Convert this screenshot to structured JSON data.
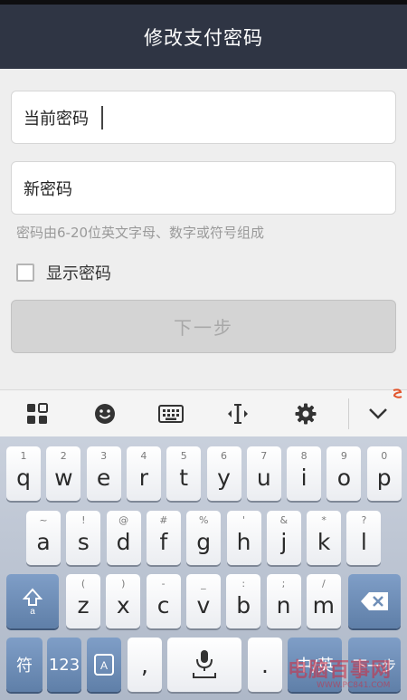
{
  "header": {
    "title": "修改支付密码"
  },
  "form": {
    "current_password_label": "当前密码",
    "new_password_label": "新密码",
    "hint": "密码由6-20位英文字母、数字或符号组成",
    "show_password_label": "显示密码",
    "next_button_label": "下一步"
  },
  "keyboard_toolbar": {
    "icons": [
      "grid-icon",
      "emoji-icon",
      "keyboard-icon",
      "text-cursor-icon",
      "gear-icon",
      "chevron-down-icon"
    ]
  },
  "keyboard": {
    "row1": [
      {
        "main": "q",
        "sub": "1"
      },
      {
        "main": "w",
        "sub": "2"
      },
      {
        "main": "e",
        "sub": "3"
      },
      {
        "main": "r",
        "sub": "4"
      },
      {
        "main": "t",
        "sub": "5"
      },
      {
        "main": "y",
        "sub": "6"
      },
      {
        "main": "u",
        "sub": "7"
      },
      {
        "main": "i",
        "sub": "8"
      },
      {
        "main": "o",
        "sub": "9"
      },
      {
        "main": "p",
        "sub": "0"
      }
    ],
    "row2": [
      {
        "main": "a",
        "sub": "~"
      },
      {
        "main": "s",
        "sub": "!"
      },
      {
        "main": "d",
        "sub": "@"
      },
      {
        "main": "f",
        "sub": "#"
      },
      {
        "main": "g",
        "sub": "%"
      },
      {
        "main": "h",
        "sub": "'"
      },
      {
        "main": "j",
        "sub": "&"
      },
      {
        "main": "k",
        "sub": "*"
      },
      {
        "main": "l",
        "sub": "?"
      }
    ],
    "row3": [
      {
        "main": "z",
        "sub": "("
      },
      {
        "main": "x",
        "sub": ")"
      },
      {
        "main": "c",
        "sub": "-"
      },
      {
        "main": "v",
        "sub": "_"
      },
      {
        "main": "b",
        "sub": ":"
      },
      {
        "main": "n",
        "sub": ";"
      },
      {
        "main": "m",
        "sub": "/"
      }
    ],
    "symbol_key": "符",
    "numbers_key": "123",
    "comma_key": ",",
    "period_key": ".",
    "lang_key": "中/英",
    "enter_key": "下一步"
  },
  "watermark": {
    "text": "电脑百事网",
    "sub": "WWW.PC841.COM"
  },
  "colors": {
    "title_bar": "#2f3544",
    "accent_key": "#6f8fb8",
    "disabled_button": "#d4d4d4"
  }
}
